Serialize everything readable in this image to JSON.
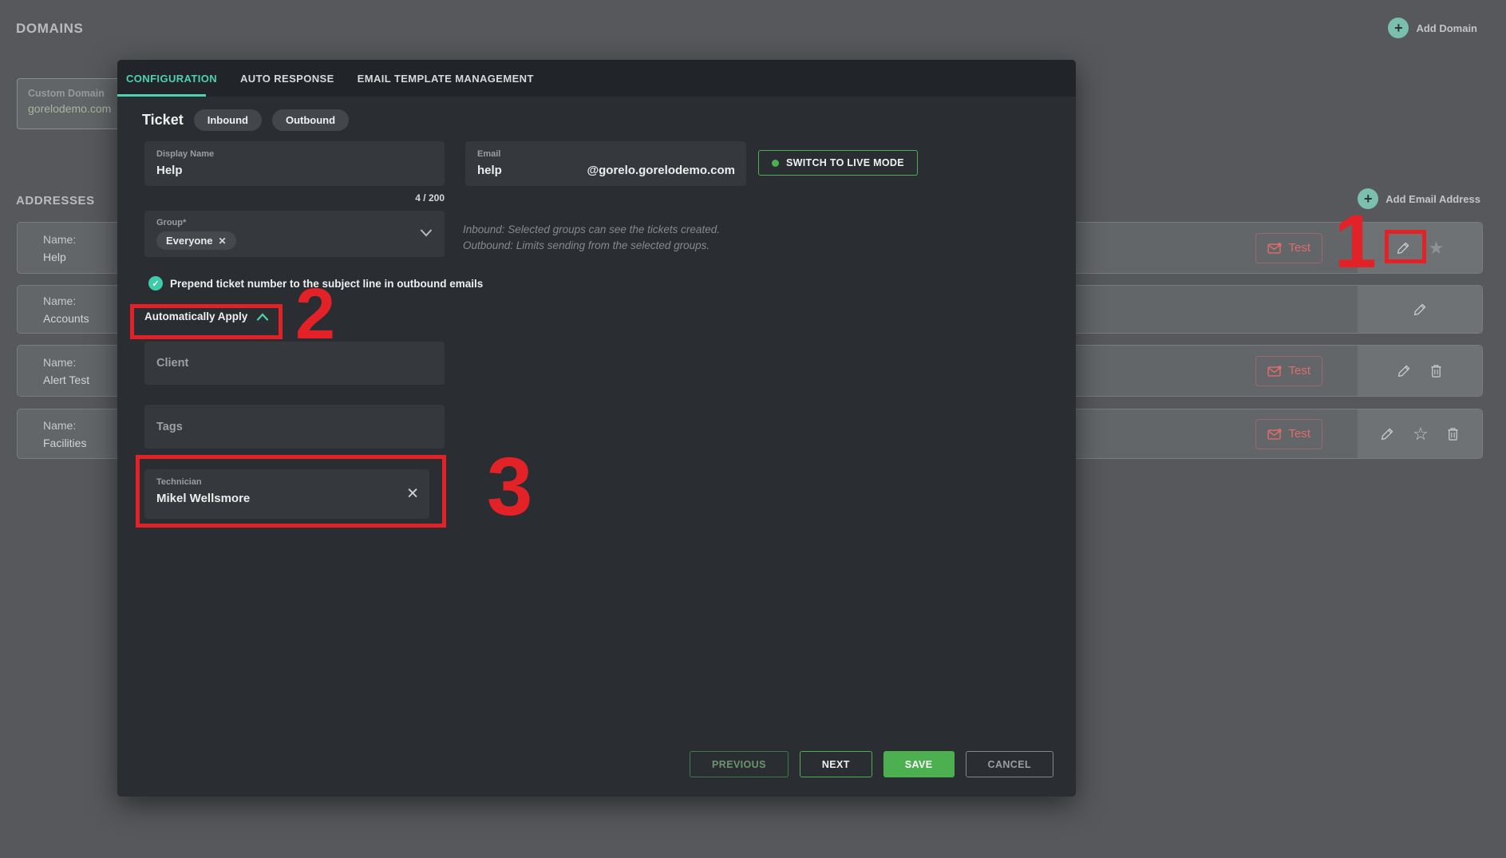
{
  "page": {
    "domains_title": "DOMAINS",
    "add_domain_label": "Add Domain",
    "custom_domain": {
      "label": "Custom Domain",
      "value": "gorelodemo.com"
    },
    "addresses_title": "ADDRESSES",
    "add_email_label": "Add Email Address",
    "name_label": "Name:",
    "test_label": "Test",
    "address_rows": [
      {
        "name": "Help"
      },
      {
        "name": "Accounts"
      },
      {
        "name": "Alert Test"
      },
      {
        "name": "Facilities"
      }
    ]
  },
  "modal": {
    "tabs": [
      {
        "label": "CONFIGURATION"
      },
      {
        "label": "AUTO RESPONSE"
      },
      {
        "label": "EMAIL TEMPLATE MANAGEMENT"
      }
    ],
    "ticket": {
      "label": "Ticket",
      "inbound": "Inbound",
      "outbound": "Outbound"
    },
    "display_name": {
      "label": "Display Name",
      "value": "Help",
      "counter": "4 / 200"
    },
    "email": {
      "label": "Email",
      "value": "help",
      "domain": "@gorelo.gorelodemo.com"
    },
    "switch_mode_label": "SWITCH TO LIVE MODE",
    "group": {
      "label": "Group*",
      "chip": "Everyone"
    },
    "group_help_line1": "Inbound: Selected groups can see the tickets created.",
    "group_help_line2": "Outbound: Limits sending from the selected groups.",
    "prepend_label": "Prepend ticket number to the subject line in outbound emails",
    "auto_apply_label": "Automatically Apply",
    "client_label": "Client",
    "tags_label": "Tags",
    "technician": {
      "label": "Technician",
      "value": "Mikel Wellsmore"
    },
    "footer": {
      "previous": "PREVIOUS",
      "next": "NEXT",
      "save": "SAVE",
      "cancel": "CANCEL"
    }
  },
  "annotations": {
    "one": "1",
    "two": "2",
    "three": "3"
  },
  "icons": {
    "plus": "+",
    "check": "✓",
    "close": "✕",
    "star_filled": "★",
    "star_outline": "☆"
  },
  "colors": {
    "accent_teal": "#4dd2b1",
    "accent_green": "#4caf50",
    "annotation_red": "#e32227",
    "test_red": "#df6c6c",
    "star_green": "#5d9e5d",
    "modal_bg": "#2a2d31",
    "page_bg": "#56585b"
  }
}
